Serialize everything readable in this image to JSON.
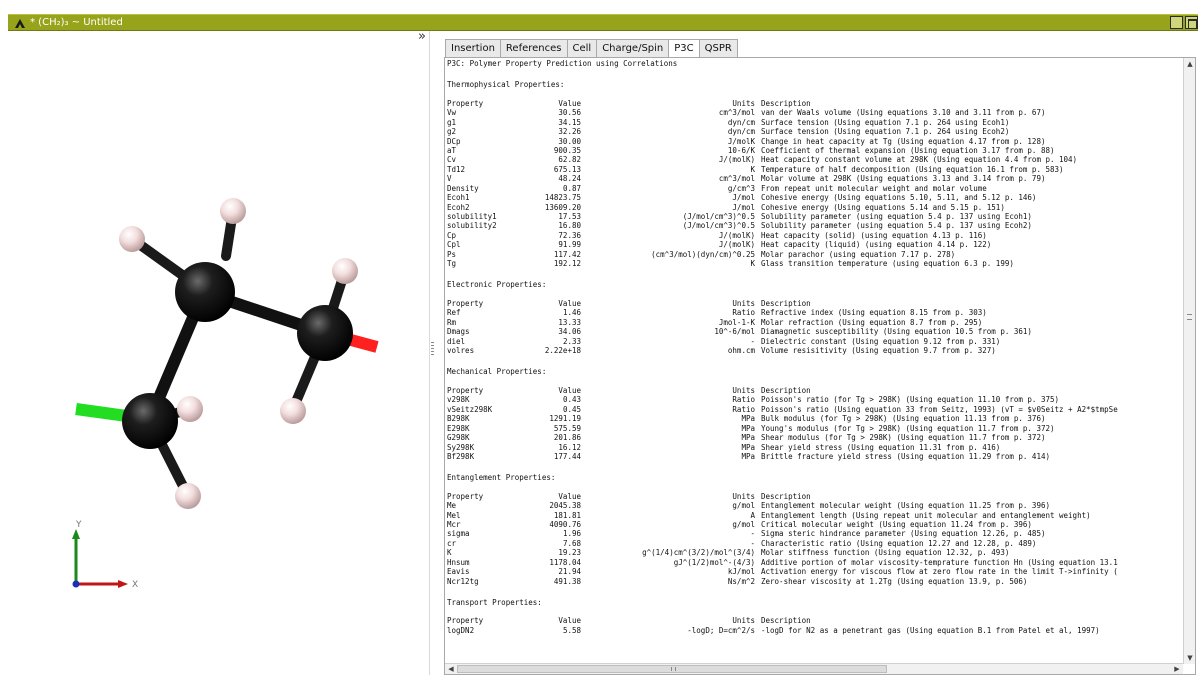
{
  "window": {
    "title": "* (CH₂)₃ ~ Untitled",
    "accent": "#97a31b"
  },
  "viewer": {
    "expand_glyph": "»",
    "axis_x": "X",
    "axis_y": "Y"
  },
  "tabs": [
    "Insertion",
    "References",
    "Cell",
    "Charge/Spin",
    "P3C",
    "QSPR"
  ],
  "active_tab": "P3C",
  "report": {
    "title": "P3C: Polymer Property Prediction using Correlations",
    "header": {
      "property": "Property",
      "value": "Value",
      "units": "Units",
      "description": "Description"
    },
    "sections": [
      {
        "name": "Thermophysical Properties:",
        "rows": [
          [
            "Vw",
            "30.56",
            "cm^3/mol",
            "van der Waals volume (Using equations 3.10 and 3.11 from p. 67)"
          ],
          [
            "g1",
            "34.15",
            "dyn/cm",
            "Surface tension (Using equation 7.1 p. 264 using Ecoh1)"
          ],
          [
            "g2",
            "32.26",
            "dyn/cm",
            "Surface tension (Using equation 7.1 p. 264 using Ecoh2)"
          ],
          [
            "DCp",
            "30.00",
            "J/molK",
            "Change in heat capacity at Tg (Using equation 4.17 from p. 128)"
          ],
          [
            "aT",
            "900.35",
            "10-6/K",
            "Coefficient of thermal expansion (Using equation 3.17 from p. 88)"
          ],
          [
            "Cv",
            "62.82",
            "J/(molK)",
            "Heat capacity constant volume at 298K (Using equation 4.4 from p. 104)"
          ],
          [
            "Td12",
            "675.13",
            "K",
            "Temperature of half decomposition (Using equation 16.1 from p. 583)"
          ],
          [
            "V",
            "48.24",
            "cm^3/mol",
            "Molar volume at 298K (Using equations 3.13 and 3.14 from p. 79)"
          ],
          [
            "Density",
            "0.87",
            "g/cm^3",
            "From repeat unit molecular weight and molar volume"
          ],
          [
            "Ecoh1",
            "14823.75",
            "J/mol",
            "Cohesive energy (Using equations 5.10, 5.11, and 5.12 p. 146)"
          ],
          [
            "Ecoh2",
            "13609.20",
            "J/mol",
            "Cohesive energy (Using equations 5.14 and 5.15 p. 151)"
          ],
          [
            "solubility1",
            "17.53",
            "(J/mol/cm^3)^0.5",
            "Solubility parameter (using equation 5.4 p. 137 using Ecoh1)"
          ],
          [
            "solubility2",
            "16.80",
            "(J/mol/cm^3)^0.5",
            "Solubility parameter (using equation 5.4 p. 137 using Ecoh2)"
          ],
          [
            "Cp",
            "72.36",
            "J/(molK)",
            "Heat capacity (solid) (using equation 4.13 p. 116)"
          ],
          [
            "Cpl",
            "91.99",
            "J/(molK)",
            "Heat capacity (liquid) (using equation 4.14 p. 122)"
          ],
          [
            "Ps",
            "117.42",
            "(cm^3/mol)(dyn/cm)^0.25",
            "Molar parachor (using equation 7.17 p. 278)"
          ],
          [
            "Tg",
            "192.12",
            "K",
            "Glass transition temperature (using equation 6.3 p. 199)"
          ]
        ]
      },
      {
        "name": "Electronic Properties:",
        "rows": [
          [
            "Ref",
            "1.46",
            "Ratio",
            "Refractive index (Using equation 8.15 from p. 303)"
          ],
          [
            "Rm",
            "13.33",
            "Jmol-1-K",
            "Molar refraction (Using equation 8.7 from p. 295)"
          ],
          [
            "Dmags",
            "34.06",
            "10^-6/mol",
            "Diamagnetic susceptibility (Using equation 10.5 from p. 361)"
          ],
          [
            "diel",
            "2.33",
            "-",
            "Dielectric constant (Using equation 9.12 from p. 331)"
          ],
          [
            "volres",
            "2.22e+18",
            "ohm.cm",
            "Volume resisitivity (Using equation 9.7 from p. 327)"
          ]
        ]
      },
      {
        "name": "Mechanical Properties:",
        "rows": [
          [
            "v298K",
            "0.43",
            "Ratio",
            "Poisson's ratio (for Tg > 298K) (Using equation 11.10 from p. 375)"
          ],
          [
            "vSeitz298K",
            "0.45",
            "Ratio",
            "Poisson's ratio (Using equation 33 from Seitz, 1993) (vT = $v0Seitz + A2*$tmpSe"
          ],
          [
            "B298K",
            "1291.19",
            "MPa",
            "Bulk modulus (for Tg > 298K) (Using equation 11.13 from p. 376)"
          ],
          [
            "E298K",
            "575.59",
            "MPa",
            "Young's modulus (for Tg > 298K) (Using equation 11.7 from p. 372)"
          ],
          [
            "G298K",
            "201.86",
            "MPa",
            "Shear modulus (for Tg > 298K) (Using equation 11.7 from p. 372)"
          ],
          [
            "Sy298K",
            "16.12",
            "MPa",
            "Shear yield stress (Using equation 11.31 from p. 416)"
          ],
          [
            "Bf298K",
            "177.44",
            "MPa",
            "Brittle fracture yield stress (Using equation 11.29 from p. 414)"
          ]
        ]
      },
      {
        "name": "Entanglement Properties:",
        "rows": [
          [
            "Me",
            "2045.38",
            "g/mol",
            "Entanglement molecular weight (Using equation 11.25 from p. 396)"
          ],
          [
            "Mel",
            "181.81",
            "A",
            "Entanglement length (Using repeat unit molecular and entanglement weight)"
          ],
          [
            "Mcr",
            "4090.76",
            "g/mol",
            "Critical molecular weight (Using equation 11.24 from p. 396)"
          ],
          [
            "sigma",
            "1.96",
            "-",
            "Sigma steric hindrance parameter (Using equation 12.26, p. 485)"
          ],
          [
            "cr",
            "7.68",
            "-",
            "Characteristic ratio (Using equation 12.27 and 12.28, p. 489)"
          ],
          [
            "K",
            "19.23",
            "g^(1/4)cm^(3/2)/mol^(3/4)",
            "Molar stiffness function (Using equation 12.32, p. 493)"
          ],
          [
            "Hnsum",
            "1178.04",
            "gJ^(1/2)mol^-(4/3)",
            "Additive portion of molar viscosity-temprature function Hn (Using equation 13.1"
          ],
          [
            "Eavis",
            "21.94",
            "kJ/mol",
            "Activation energy for viscous flow at zero flow rate in the limit T->infinity ("
          ],
          [
            "Ncr12tg",
            "491.38",
            "Ns/m^2",
            "Zero-shear viscosity at 1.2Tg (Using equation 13.9, p. 506)"
          ]
        ]
      },
      {
        "name": "Transport Properties:",
        "rows": [
          [
            "logDN2",
            "5.58",
            "-logD; D=cm^2/s",
            "-logD for N2 as a penetrant gas (Using equation B.1 from Patel et al, 1997)"
          ]
        ]
      }
    ]
  },
  "colors": {
    "carbon": "#111111",
    "hydrogen": "#f3dede",
    "bond_red": "#ff2020",
    "bond_green": "#22dd22",
    "axis_x": "#c21515",
    "axis_y": "#1a8a1a",
    "axis_z": "#1c2fb8"
  }
}
